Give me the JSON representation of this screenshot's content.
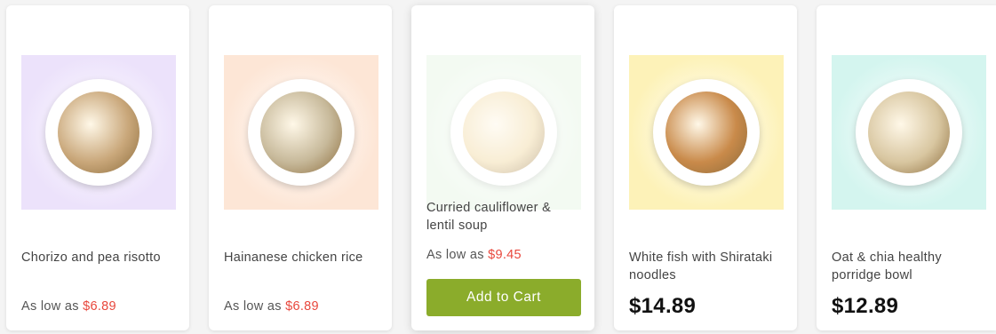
{
  "products": [
    {
      "name": "Chorizo and pea risotto",
      "price_prefix": "As low as",
      "price": "$6.89",
      "bg": "#ece2fb",
      "food_color": "#c9a77a"
    },
    {
      "name": "Hainanese chicken rice",
      "price_prefix": "As low as",
      "price": "$6.89",
      "bg": "#fde6d6",
      "food_color": "#c7b99a"
    },
    {
      "name": "Curried cauliflower & lentil soup",
      "price_prefix": "As low as",
      "price": "$9.45",
      "add_to_cart": "Add to Cart",
      "bg": "#e6f6e4",
      "food_color": "#f1d9a2"
    },
    {
      "name": "White fish with Shirataki noodles",
      "price": "$14.89",
      "bg": "#fdf2b8",
      "food_color": "#c98a4a"
    },
    {
      "name": "Oat & chia healthy porridge bowl",
      "price": "$12.89",
      "bg": "#d4f5ef",
      "food_color": "#d8c6a0"
    }
  ],
  "colors": {
    "price_red": "#e8473c",
    "cart_green": "#8bac2b"
  }
}
